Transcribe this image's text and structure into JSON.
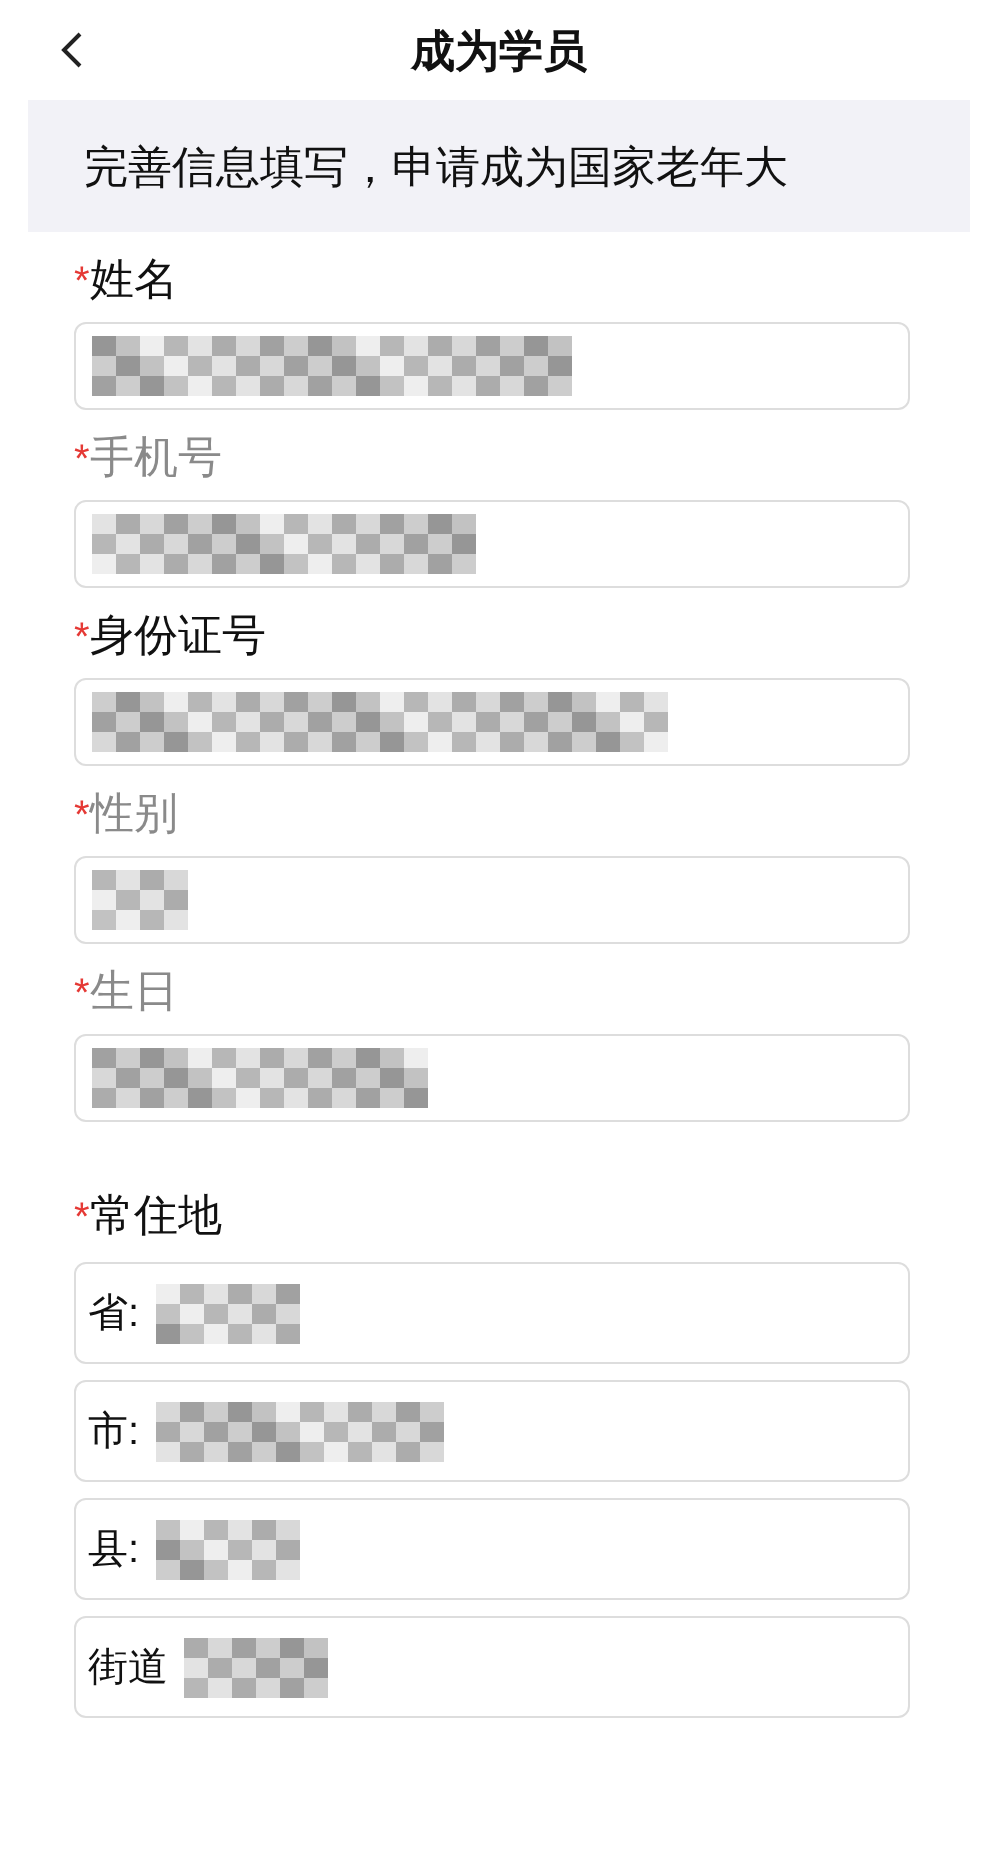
{
  "header": {
    "title": "成为学员"
  },
  "banner": {
    "text": "完善信息填写，申请成为国家老年大"
  },
  "fields": [
    {
      "label": "姓名",
      "required_mark": "*",
      "disabled": false
    },
    {
      "label": "手机号",
      "required_mark": "*",
      "disabled": true
    },
    {
      "label": "身份证号",
      "required_mark": "*",
      "disabled": false
    },
    {
      "label": "性别",
      "required_mark": "*",
      "disabled": true
    },
    {
      "label": "生日",
      "required_mark": "*",
      "disabled": true
    }
  ],
  "address": {
    "label": "常住地",
    "required_mark": "*",
    "disabled": false,
    "parts": [
      {
        "prefix": "省:"
      },
      {
        "prefix": "市:"
      },
      {
        "prefix": "县:"
      },
      {
        "prefix": "街道"
      }
    ]
  }
}
